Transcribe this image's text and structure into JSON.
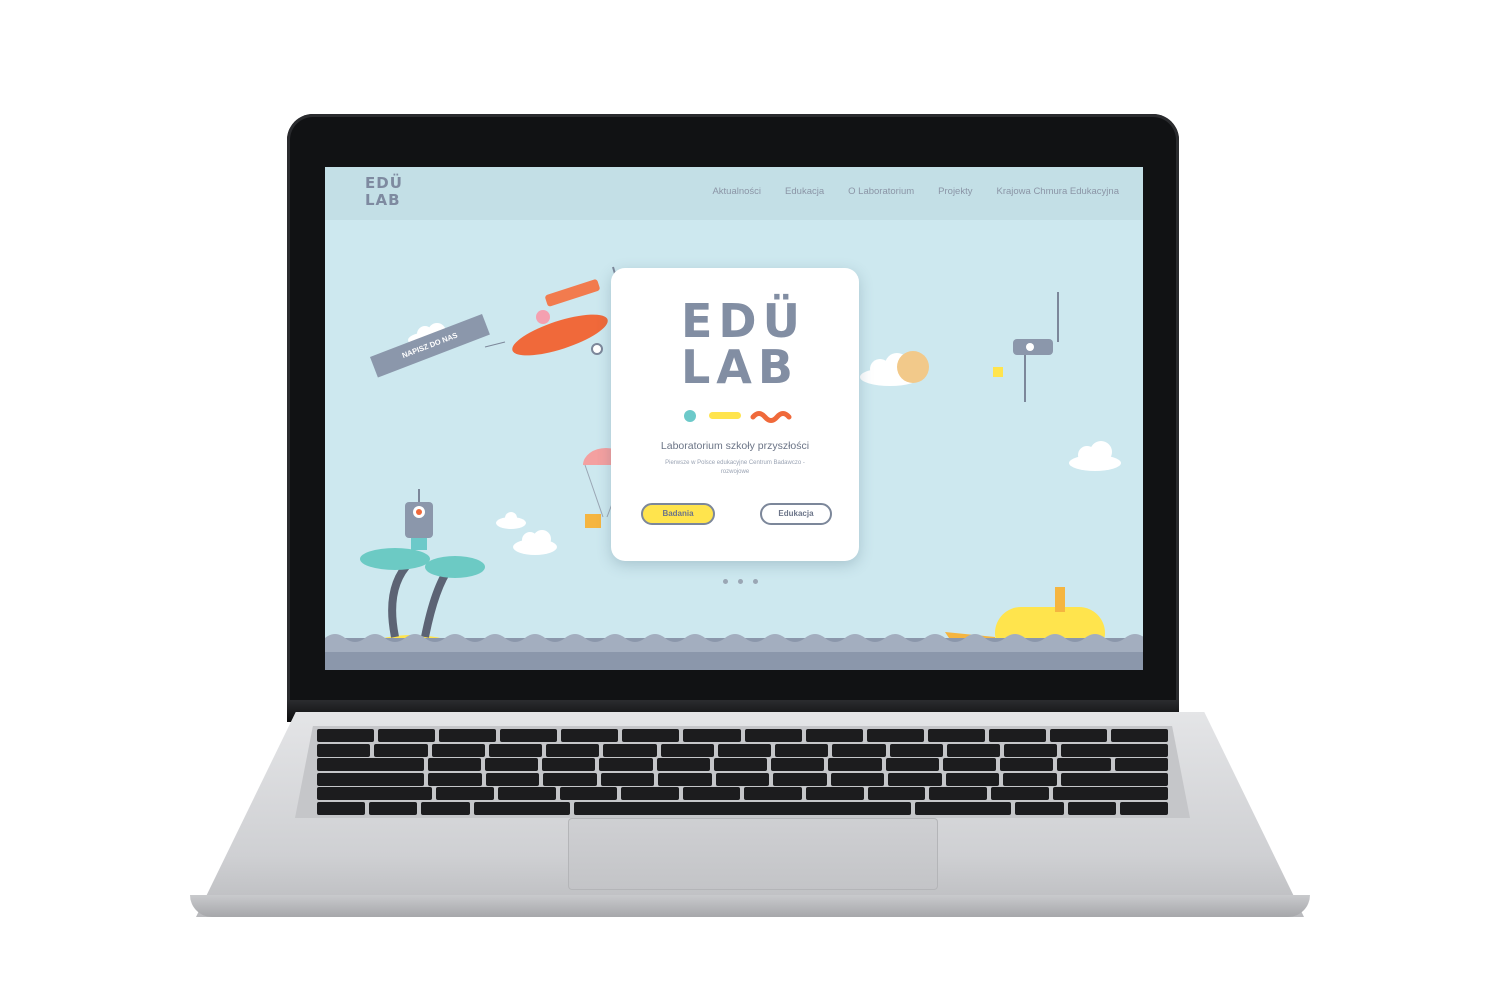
{
  "site": {
    "logo_line1": "EDÜ",
    "logo_line2": "LAB",
    "nav": [
      {
        "label": "Aktualności"
      },
      {
        "label": "Edukacja"
      },
      {
        "label": "O Laboratorium"
      },
      {
        "label": "Projekty"
      },
      {
        "label": "Krajowa Chmura Edukacyjna"
      }
    ]
  },
  "hero": {
    "logo_line1": "EDÜ",
    "logo_line2": "LAB",
    "title": "Laboratorium szkoły przyszłości",
    "subtitle": "Pierwsze w Polsce edukacyjne Centrum Badawczo - rozwojowe",
    "primary_button": "Badania",
    "secondary_button": "Edukacja",
    "banner_text": "NAPISZ DO NAS",
    "slides_count": 3
  },
  "colors": {
    "sky": "#cde8ef",
    "navbar": "#c3dfe6",
    "text_gray": "#7e8aa0",
    "yellow": "#ffe44d",
    "orange": "#f0693a",
    "teal": "#6cc9c9"
  }
}
